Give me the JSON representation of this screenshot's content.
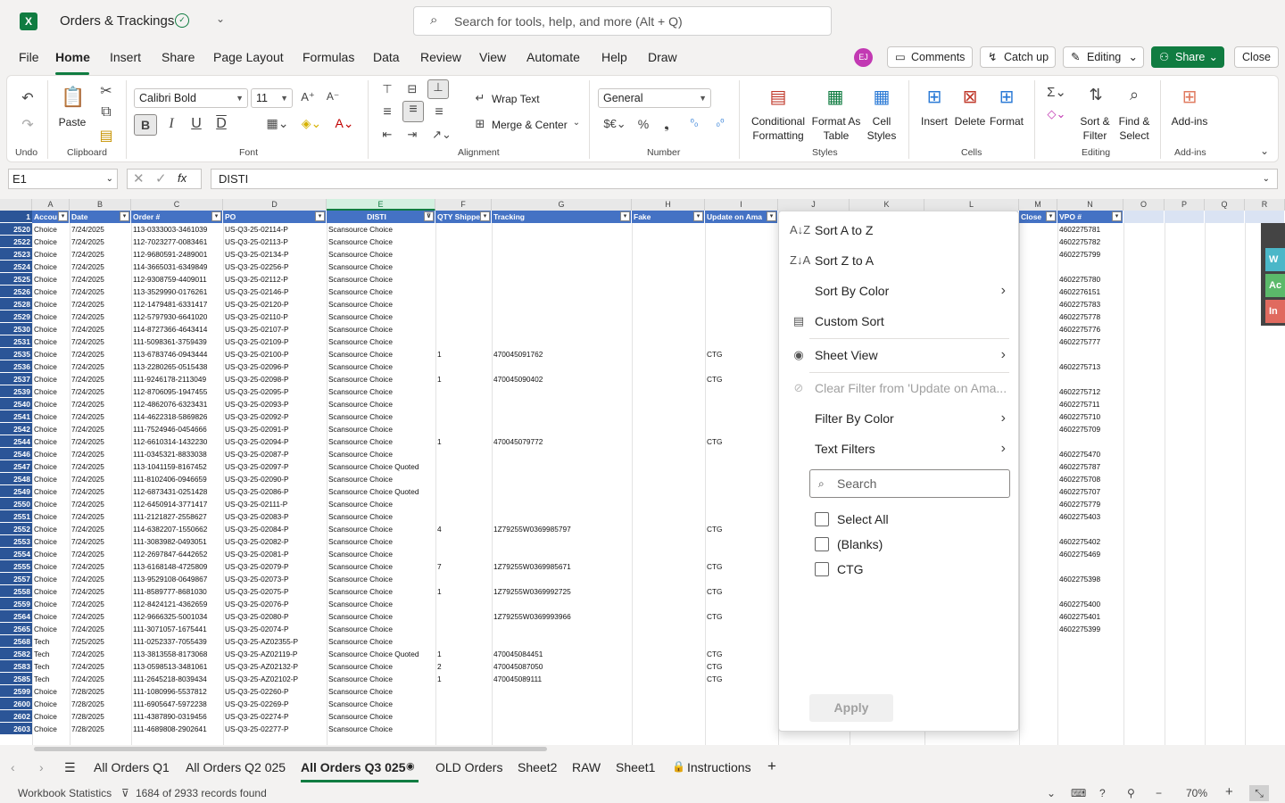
{
  "app": {
    "title": "Orders & Trackings",
    "search_placeholder": "Search for tools, help, and more (Alt + Q)"
  },
  "menu": [
    "File",
    "Home",
    "Insert",
    "Share",
    "Page Layout",
    "Formulas",
    "Data",
    "Review",
    "View",
    "Automate",
    "Help",
    "Draw"
  ],
  "user": {
    "initials": "EJ"
  },
  "top_buttons": {
    "comments": "Comments",
    "catchup": "Catch up",
    "editing": "Editing",
    "share": "Share",
    "close": "Close"
  },
  "ribbon": {
    "undo_group": "Undo",
    "paste": "Paste",
    "clipboard": "Clipboard",
    "font_name": "Calibri Bold",
    "font_size": "11",
    "font": "Font",
    "wrap_text": "Wrap Text",
    "merge_center": "Merge & Center",
    "alignment": "Alignment",
    "number_format": "General",
    "number": "Number",
    "conditional": "Conditional",
    "formatting": "Formatting",
    "format_as": "Format As",
    "table": "Table",
    "cell": "Cell",
    "styles_btn": "Styles",
    "styles": "Styles",
    "insert": "Insert",
    "delete": "Delete",
    "format": "Format",
    "cells": "Cells",
    "sort": "Sort &",
    "filter": "Filter",
    "find": "Find &",
    "select": "Select",
    "editing": "Editing",
    "addins_btn": "Add-ins",
    "addins": "Add-ins"
  },
  "formula_bar": {
    "name_box": "E1",
    "formula": "DISTI"
  },
  "columns": [
    "A",
    "B",
    "C",
    "D",
    "E",
    "F",
    "G",
    "H",
    "I",
    "J",
    "K",
    "L",
    "M",
    "N",
    "O",
    "P",
    "Q",
    "R"
  ],
  "headers": {
    "A": "Accou",
    "B": "Date",
    "C": "Order #",
    "D": "PO",
    "E": "DISTI",
    "F": "QTY Shippe",
    "G": "Tracking",
    "H": "Fake",
    "I": "Update on Ama",
    "M": "Close",
    "N": "VPO #"
  },
  "rows": [
    [
      "2520",
      "Choice",
      "7/24/2025",
      "113-0333003-3461039",
      "US-Q3-25-02114-P",
      "Scansource Choice",
      "",
      "",
      "",
      "",
      "4602275781"
    ],
    [
      "2522",
      "Choice",
      "7/24/2025",
      "112-7023277-0083461",
      "US-Q3-25-02113-P",
      "Scansource Choice",
      "",
      "",
      "",
      "",
      "4602275782"
    ],
    [
      "2523",
      "Choice",
      "7/24/2025",
      "112-9680591-2489001",
      "US-Q3-25-02134-P",
      "Scansource Choice",
      "",
      "",
      "",
      "",
      "4602275799"
    ],
    [
      "2524",
      "Choice",
      "7/24/2025",
      "114-3665031-6349849",
      "US-Q3-25-02256-P",
      "Scansource Choice",
      "",
      "",
      "",
      "",
      ""
    ],
    [
      "2525",
      "Choice",
      "7/24/2025",
      "112-9308759-4409011",
      "US-Q3-25-02112-P",
      "Scansource Choice",
      "",
      "",
      "",
      "",
      "4602275780"
    ],
    [
      "2526",
      "Choice",
      "7/24/2025",
      "113-3529990-0176261",
      "US-Q3-25-02146-P",
      "Scansource Choice",
      "",
      "",
      "",
      "",
      "4602276151"
    ],
    [
      "2528",
      "Choice",
      "7/24/2025",
      "112-1479481-6331417",
      "US-Q3-25-02120-P",
      "Scansource Choice",
      "",
      "",
      "",
      "",
      "4602275783"
    ],
    [
      "2529",
      "Choice",
      "7/24/2025",
      "112-5797930-6641020",
      "US-Q3-25-02110-P",
      "Scansource Choice",
      "",
      "",
      "",
      "",
      "4602275778"
    ],
    [
      "2530",
      "Choice",
      "7/24/2025",
      "114-8727366-4643414",
      "US-Q3-25-02107-P",
      "Scansource Choice",
      "",
      "",
      "",
      "",
      "4602275776"
    ],
    [
      "2531",
      "Choice",
      "7/24/2025",
      "111-5098361-3759439",
      "US-Q3-25-02109-P",
      "Scansource Choice",
      "",
      "",
      "",
      "",
      "4602275777"
    ],
    [
      "2535",
      "Choice",
      "7/24/2025",
      "113-6783746-0943444",
      "US-Q3-25-02100-P",
      "Scansource Choice",
      "1",
      "470045091762",
      "CTG",
      "",
      ""
    ],
    [
      "2536",
      "Choice",
      "7/24/2025",
      "113-2280265-0515438",
      "US-Q3-25-02096-P",
      "Scansource Choice",
      "",
      "",
      "",
      "",
      "4602275713"
    ],
    [
      "2537",
      "Choice",
      "7/24/2025",
      "111-9246178-2113049",
      "US-Q3-25-02098-P",
      "Scansource Choice",
      "1",
      "470045090402",
      "CTG",
      "",
      ""
    ],
    [
      "2539",
      "Choice",
      "7/24/2025",
      "112-8706095-1947455",
      "US-Q3-25-02095-P",
      "Scansource Choice",
      "",
      "",
      "",
      "",
      "4602275712"
    ],
    [
      "2540",
      "Choice",
      "7/24/2025",
      "112-4862076-6323431",
      "US-Q3-25-02093-P",
      "Scansource Choice",
      "",
      "",
      "",
      "",
      "4602275711"
    ],
    [
      "2541",
      "Choice",
      "7/24/2025",
      "114-4622318-5869826",
      "US-Q3-25-02092-P",
      "Scansource Choice",
      "",
      "",
      "",
      "",
      "4602275710"
    ],
    [
      "2542",
      "Choice",
      "7/24/2025",
      "111-7524946-0454666",
      "US-Q3-25-02091-P",
      "Scansource Choice",
      "",
      "",
      "",
      "",
      "4602275709"
    ],
    [
      "2544",
      "Choice",
      "7/24/2025",
      "112-6610314-1432230",
      "US-Q3-25-02094-P",
      "Scansource Choice",
      "1",
      "470045079772",
      "CTG",
      "",
      ""
    ],
    [
      "2546",
      "Choice",
      "7/24/2025",
      "111-0345321-8833038",
      "US-Q3-25-02087-P",
      "Scansource Choice",
      "",
      "",
      "",
      "",
      "4602275470"
    ],
    [
      "2547",
      "Choice",
      "7/24/2025",
      "113-1041159-8167452",
      "US-Q3-25-02097-P",
      "Scansource Choice Quoted",
      "",
      "",
      "",
      "",
      "4602275787"
    ],
    [
      "2548",
      "Choice",
      "7/24/2025",
      "111-8102406-0946659",
      "US-Q3-25-02090-P",
      "Scansource Choice",
      "",
      "",
      "",
      "",
      "4602275708"
    ],
    [
      "2549",
      "Choice",
      "7/24/2025",
      "112-6873431-0251428",
      "US-Q3-25-02086-P",
      "Scansource Choice Quoted",
      "",
      "",
      "",
      "",
      "4602275707"
    ],
    [
      "2550",
      "Choice",
      "7/24/2025",
      "112-6450914-3771417",
      "US-Q3-25-02111-P",
      "Scansource Choice",
      "",
      "",
      "",
      "",
      "4602275779"
    ],
    [
      "2551",
      "Choice",
      "7/24/2025",
      "111-2121827-2558627",
      "US-Q3-25-02083-P",
      "Scansource Choice",
      "",
      "",
      "",
      "",
      "4602275403"
    ],
    [
      "2552",
      "Choice",
      "7/24/2025",
      "114-6382207-1550662",
      "US-Q3-25-02084-P",
      "Scansource Choice",
      "4",
      "1Z79255W0369985797",
      "CTG",
      "",
      ""
    ],
    [
      "2553",
      "Choice",
      "7/24/2025",
      "111-3083982-0493051",
      "US-Q3-25-02082-P",
      "Scansource Choice",
      "",
      "",
      "",
      "",
      "4602275402"
    ],
    [
      "2554",
      "Choice",
      "7/24/2025",
      "112-2697847-6442652",
      "US-Q3-25-02081-P",
      "Scansource Choice",
      "",
      "",
      "",
      "",
      "4602275469"
    ],
    [
      "2555",
      "Choice",
      "7/24/2025",
      "113-6168148-4725809",
      "US-Q3-25-02079-P",
      "Scansource Choice",
      "7",
      "1Z79255W0369985671",
      "CTG",
      "",
      ""
    ],
    [
      "2557",
      "Choice",
      "7/24/2025",
      "113-9529108-0649867",
      "US-Q3-25-02073-P",
      "Scansource Choice",
      "",
      "",
      "",
      "",
      "4602275398"
    ],
    [
      "2558",
      "Choice",
      "7/24/2025",
      "111-8589777-8681030",
      "US-Q3-25-02075-P",
      "Scansource Choice",
      "1",
      "1Z79255W0369992725",
      "CTG",
      "",
      ""
    ],
    [
      "2559",
      "Choice",
      "7/24/2025",
      "112-8424121-4362659",
      "US-Q3-25-02076-P",
      "Scansource Choice",
      "",
      "",
      "",
      "",
      "4602275400"
    ],
    [
      "2564",
      "Choice",
      "7/24/2025",
      "112-9666325-5001034",
      "US-Q3-25-02080-P",
      "Scansource Choice",
      "",
      "1Z79255W0369993966",
      "CTG",
      "",
      "4602275401"
    ],
    [
      "2565",
      "Choice",
      "7/24/2025",
      "111-3071057-1675441",
      "US-Q3-25-02074-P",
      "Scansource Choice",
      "",
      "",
      "",
      "",
      "4602275399"
    ],
    [
      "2568",
      "Tech",
      "7/25/2025",
      "111-0252337-7055439",
      "US-Q3-25-AZ02355-P",
      "Scansource Choice",
      "",
      "",
      "",
      "",
      ""
    ],
    [
      "2582",
      "Tech",
      "7/24/2025",
      "113-3813558-8173068",
      "US-Q3-25-AZ02119-P",
      "Scansource Choice Quoted",
      "1",
      "470045084451",
      "CTG",
      "",
      ""
    ],
    [
      "2583",
      "Tech",
      "7/24/2025",
      "113-0598513-3481061",
      "US-Q3-25-AZ02132-P",
      "Scansource Choice",
      "2",
      "470045087050",
      "CTG",
      "",
      ""
    ],
    [
      "2585",
      "Tech",
      "7/24/2025",
      "111-2645218-8039434",
      "US-Q3-25-AZ02102-P",
      "Scansource Choice",
      "1",
      "470045089111",
      "CTG",
      "",
      ""
    ],
    [
      "2599",
      "Choice",
      "7/28/2025",
      "111-1080996-5537812",
      "US-Q3-25-02260-P",
      "Scansource Choice",
      "",
      "",
      "",
      "",
      ""
    ],
    [
      "2600",
      "Choice",
      "7/28/2025",
      "111-6905647-5972238",
      "US-Q3-25-02269-P",
      "Scansource Choice",
      "",
      "",
      "",
      "",
      ""
    ],
    [
      "2602",
      "Choice",
      "7/28/2025",
      "111-4387890-0319456",
      "US-Q3-25-02274-P",
      "Scansource Choice",
      "",
      "",
      "",
      "",
      ""
    ],
    [
      "2603",
      "Choice",
      "7/28/2025",
      "111-4689808-2902641",
      "US-Q3-25-02277-P",
      "Scansource Choice",
      "",
      "",
      "",
      "",
      ""
    ]
  ],
  "filter_menu": {
    "sort_az": "Sort A to Z",
    "sort_za": "Sort Z to A",
    "sort_color": "Sort By Color",
    "custom_sort": "Custom Sort",
    "sheet_view": "Sheet View",
    "clear_filter": "Clear Filter from 'Update on Ama...",
    "filter_color": "Filter By Color",
    "text_filters": "Text Filters",
    "search_placeholder": "Search",
    "options": [
      "Select All",
      "(Blanks)",
      "CTG"
    ],
    "apply": "Apply"
  },
  "sheets": [
    "All Orders Q1",
    "All Orders Q2 025",
    "All Orders Q3 025",
    "OLD Orders",
    "Sheet2",
    "RAW",
    "Sheet1",
    "Instructions"
  ],
  "active_sheet": "All Orders Q3 025",
  "status": {
    "workbook_stats": "Workbook Statistics",
    "records": "1684 of 2933 records found",
    "zoom": "70%"
  },
  "side_panel": [
    "W",
    "Ac",
    "In"
  ],
  "colors": {
    "accent": "#107c41",
    "header_blue": "#4472c4",
    "rownum_blue": "#2b5597"
  }
}
